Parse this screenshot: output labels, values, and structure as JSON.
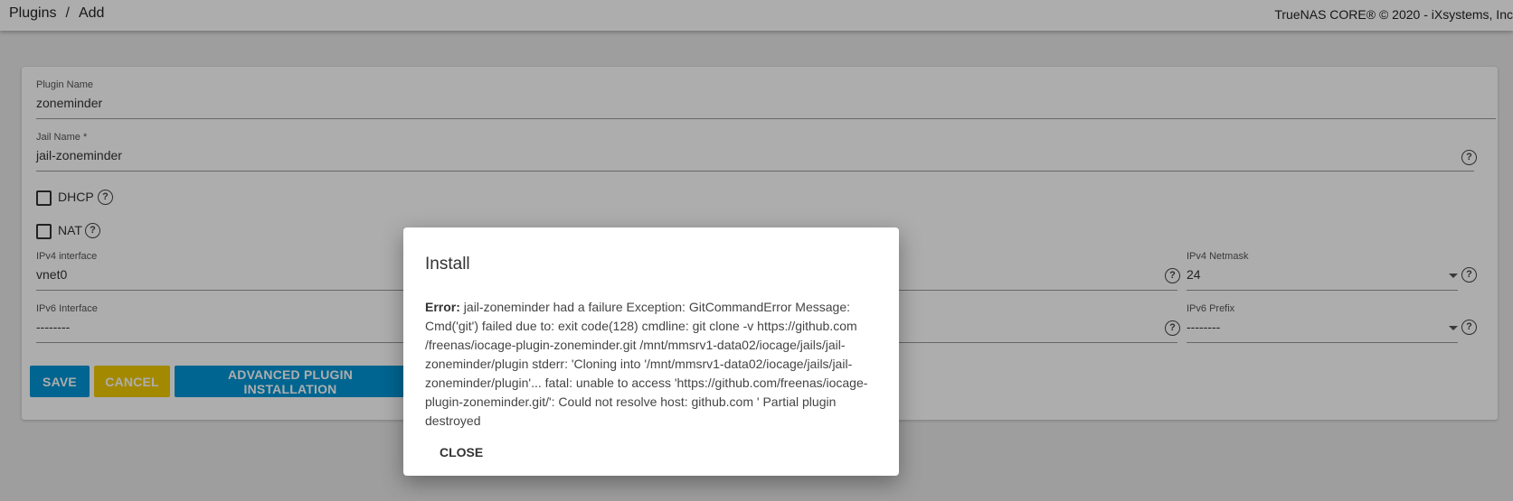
{
  "header": {
    "breadcrumb": [
      "Plugins",
      "Add"
    ],
    "separator": "/",
    "copyright": "TrueNAS CORE® © 2020 - iXsystems, Inc"
  },
  "form": {
    "plugin_name": {
      "label": "Plugin Name",
      "value": "zoneminder"
    },
    "jail_name": {
      "label": "Jail Name *",
      "value": "jail-zoneminder"
    },
    "dhcp": {
      "label": "DHCP",
      "checked": false
    },
    "nat": {
      "label": "NAT",
      "checked": false
    },
    "ipv4_interface": {
      "label": "IPv4 interface",
      "value": "vnet0"
    },
    "ipv4_netmask": {
      "label": "IPv4 Netmask",
      "value": "24"
    },
    "ipv6_interface": {
      "label": "IPv6 Interface",
      "value": "--------"
    },
    "ipv6_prefix": {
      "label": "IPv6 Prefix",
      "value": "--------"
    },
    "buttons": {
      "save": "SAVE",
      "cancel": "CANCEL",
      "advanced": "ADVANCED PLUGIN INSTALLATION"
    },
    "help_icon_glyph": "?"
  },
  "dialog": {
    "title": "Install",
    "error_label": "Error:",
    "error_text": "jail-zoneminder had a failure Exception: GitCommandError Message: Cmd('git') failed due to: exit code(128) cmdline: git clone -v https://github.com /freenas/iocage-plugin-zoneminder.git /mnt/mmsrv1-data02/iocage/jails/jail-zoneminder/plugin stderr: 'Cloning into '/mnt/mmsrv1-data02/iocage/jails/jail-zoneminder/plugin'... fatal: unable to access 'https://github.com/freenas/iocage-plugin-zoneminder.git/': Could not resolve host: github.com ' Partial plugin destroyed",
    "close_label": "CLOSE"
  },
  "colors": {
    "primary": "#0095d5",
    "accent": "#f0cb00",
    "overlay": "rgba(0,0,0,0.32)"
  }
}
